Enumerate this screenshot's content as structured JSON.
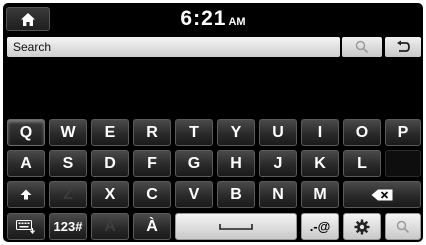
{
  "status_bar": {
    "home_icon": "home-icon",
    "time": "6:21",
    "ampm": "AM"
  },
  "search": {
    "placeholder": "Search",
    "search_icon": "search-icon",
    "back_icon": "back-arrow-icon"
  },
  "keyboard": {
    "row1": [
      "Q",
      "W",
      "E",
      "R",
      "T",
      "Y",
      "U",
      "I",
      "O",
      "P"
    ],
    "row2": [
      "A",
      "S",
      "D",
      "F",
      "G",
      "H",
      "J",
      "K",
      "L"
    ],
    "row3": [
      "Z",
      "X",
      "C",
      "V",
      "B",
      "N",
      "M"
    ],
    "row4": {
      "numbers_label": "123#",
      "accent_a": "A",
      "accent_a_grave": "À",
      "symbols_label": ".-@"
    },
    "icons": {
      "shift": "shift-up-icon",
      "backspace": "backspace-icon",
      "keyboard_switch": "keyboard-switch-icon",
      "space": "space-bar-icon",
      "settings": "gear-icon",
      "search": "search-icon"
    }
  }
}
